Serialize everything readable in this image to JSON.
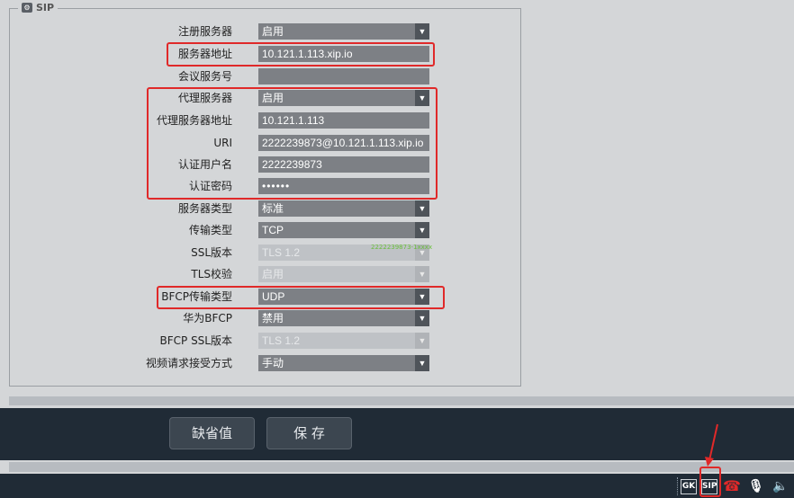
{
  "legend": {
    "title": "SIP",
    "icon": "gear-icon"
  },
  "rows": [
    {
      "label": "注册服务器",
      "value": "启用",
      "type": "select"
    },
    {
      "label": "服务器地址",
      "value": "10.121.1.113.xip.io",
      "type": "text"
    },
    {
      "label": "会议服务号",
      "value": "",
      "type": "text"
    },
    {
      "label": "代理服务器",
      "value": "启用",
      "type": "select"
    },
    {
      "label": "代理服务器地址",
      "value": "10.121.1.113",
      "type": "text"
    },
    {
      "label": "URI",
      "value": "2222239873@10.121.1.113.xip.io",
      "type": "text"
    },
    {
      "label": "认证用户名",
      "value": "2222239873",
      "type": "text"
    },
    {
      "label": "认证密码",
      "value": "••••••",
      "type": "password"
    },
    {
      "label": "服务器类型",
      "value": "标准",
      "type": "select"
    },
    {
      "label": "传输类型",
      "value": "TCP",
      "type": "select"
    },
    {
      "label": "SSL版本",
      "value": "TLS 1.2",
      "type": "select",
      "disabled": true
    },
    {
      "label": "TLS校验",
      "value": "启用",
      "type": "select",
      "disabled": true
    },
    {
      "label": "BFCP传输类型",
      "value": "UDP",
      "type": "select"
    },
    {
      "label": "华为BFCP",
      "value": "禁用",
      "type": "select"
    },
    {
      "label": "BFCP SSL版本",
      "value": "TLS 1.2",
      "type": "select",
      "disabled": true
    },
    {
      "label": "视频请求接受方式",
      "value": "手动",
      "type": "select"
    }
  ],
  "watermark": "2222239873-1xxxx",
  "buttons": {
    "default": "缺省值",
    "save": "保  存"
  },
  "status": {
    "gk": "GK",
    "sip": "SIP"
  },
  "colors": {
    "highlight": "#e02929",
    "dark_bar": "#202b36",
    "field": "#7d8085"
  }
}
